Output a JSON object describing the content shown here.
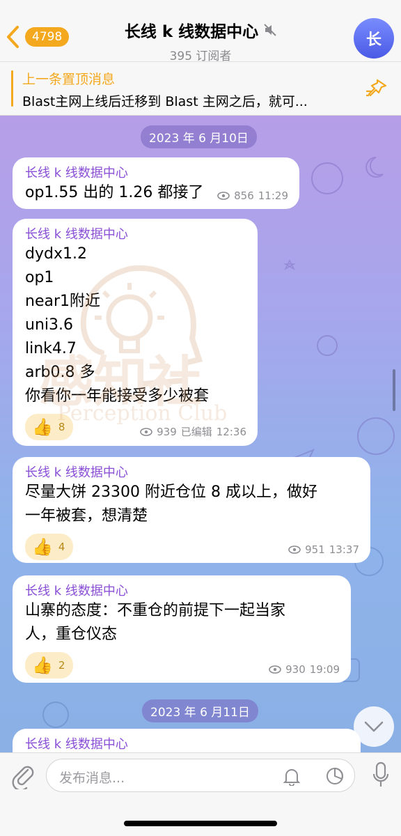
{
  "header": {
    "back_count": "4798",
    "title": "长线 k 线数据中心",
    "subscribers": "395 订阅者",
    "avatar_letter": "长"
  },
  "pinned": {
    "label": "上一条置顶消息",
    "text": "Blast主网上线后迁移到 Blast 主网之后，就可..."
  },
  "watermark": {
    "main": "感知社",
    "sub": "Perception Club"
  },
  "dates": [
    "2023 年 6 月10日",
    "2023 年 6 月11日"
  ],
  "messages": [
    {
      "sender": "长线 k 线数据中心",
      "lines": [
        "op1.55 出的 1.26 都接了"
      ],
      "views": "856",
      "time": "11:29"
    },
    {
      "sender": "长线 k 线数据中心",
      "lines": [
        "dydx1.2",
        "op1",
        "near1附近",
        "uni3.6",
        "link4.7",
        "arb0.8 多",
        "你看你一年能接受多少被套"
      ],
      "reaction_count": "8",
      "views": "939",
      "edited": "已编辑",
      "time": "12:36"
    },
    {
      "sender": "长线 k 线数据中心",
      "lines": [
        "尽量大饼 23300 附近仓位 8 成以上，做好",
        "一年被套，想清楚"
      ],
      "reaction_count": "4",
      "views": "951",
      "time": "13:37"
    },
    {
      "sender": "长线 k 线数据中心",
      "lines": [
        "山寨的态度：不重仓的前提下一起当家",
        "人，重仓仪态"
      ],
      "reaction_count": "2",
      "views": "930",
      "time": "19:09"
    },
    {
      "sender": "长线 k 线数据中心"
    }
  ],
  "input": {
    "placeholder": "发布消息..."
  },
  "colors": {
    "accent": "#f4a81d",
    "sender": "#8a4fd6",
    "avatar": "#5b6cf0"
  }
}
